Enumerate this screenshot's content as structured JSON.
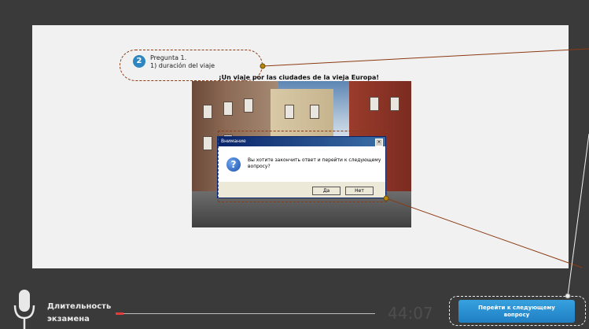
{
  "question": {
    "step_number": "2",
    "line1": "Pregunta 1.",
    "line2": "1) duración del viaje"
  },
  "image": {
    "title": "¡Un viaje por las ciudades de la vieja Europa!"
  },
  "dialog": {
    "title": "Внимание",
    "close_glyph": "×",
    "icon": "question-icon",
    "message": "Вы хотите закончить ответ и перейти к следующему вопросу?",
    "yes_label": "Да",
    "no_label": "Нет"
  },
  "footer": {
    "mic_icon": "microphone-icon",
    "duration_label": "Длительность экзамена",
    "progress_fraction": 0.03,
    "timer": "44:07",
    "next_button_label": "Перейти к следующему вопросу"
  },
  "colors": {
    "background": "#3a3a3a",
    "panel": "#f1f1f1",
    "accent": "#2e86c1",
    "callout": "#8b3a12",
    "progress": "#e23c3c"
  }
}
